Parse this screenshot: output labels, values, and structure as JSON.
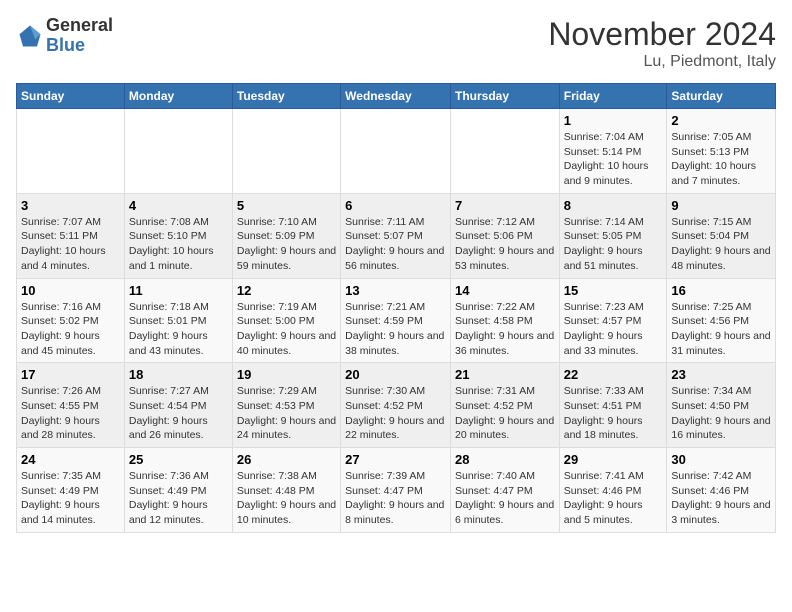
{
  "header": {
    "logo_line1": "General",
    "logo_line2": "Blue",
    "month": "November 2024",
    "location": "Lu, Piedmont, Italy"
  },
  "weekdays": [
    "Sunday",
    "Monday",
    "Tuesday",
    "Wednesday",
    "Thursday",
    "Friday",
    "Saturday"
  ],
  "weeks": [
    [
      {
        "day": "",
        "info": ""
      },
      {
        "day": "",
        "info": ""
      },
      {
        "day": "",
        "info": ""
      },
      {
        "day": "",
        "info": ""
      },
      {
        "day": "",
        "info": ""
      },
      {
        "day": "1",
        "info": "Sunrise: 7:04 AM\nSunset: 5:14 PM\nDaylight: 10 hours\nand 9 minutes."
      },
      {
        "day": "2",
        "info": "Sunrise: 7:05 AM\nSunset: 5:13 PM\nDaylight: 10 hours\nand 7 minutes."
      }
    ],
    [
      {
        "day": "3",
        "info": "Sunrise: 7:07 AM\nSunset: 5:11 PM\nDaylight: 10 hours\nand 4 minutes."
      },
      {
        "day": "4",
        "info": "Sunrise: 7:08 AM\nSunset: 5:10 PM\nDaylight: 10 hours\nand 1 minute."
      },
      {
        "day": "5",
        "info": "Sunrise: 7:10 AM\nSunset: 5:09 PM\nDaylight: 9 hours\nand 59 minutes."
      },
      {
        "day": "6",
        "info": "Sunrise: 7:11 AM\nSunset: 5:07 PM\nDaylight: 9 hours\nand 56 minutes."
      },
      {
        "day": "7",
        "info": "Sunrise: 7:12 AM\nSunset: 5:06 PM\nDaylight: 9 hours\nand 53 minutes."
      },
      {
        "day": "8",
        "info": "Sunrise: 7:14 AM\nSunset: 5:05 PM\nDaylight: 9 hours\nand 51 minutes."
      },
      {
        "day": "9",
        "info": "Sunrise: 7:15 AM\nSunset: 5:04 PM\nDaylight: 9 hours\nand 48 minutes."
      }
    ],
    [
      {
        "day": "10",
        "info": "Sunrise: 7:16 AM\nSunset: 5:02 PM\nDaylight: 9 hours\nand 45 minutes."
      },
      {
        "day": "11",
        "info": "Sunrise: 7:18 AM\nSunset: 5:01 PM\nDaylight: 9 hours\nand 43 minutes."
      },
      {
        "day": "12",
        "info": "Sunrise: 7:19 AM\nSunset: 5:00 PM\nDaylight: 9 hours\nand 40 minutes."
      },
      {
        "day": "13",
        "info": "Sunrise: 7:21 AM\nSunset: 4:59 PM\nDaylight: 9 hours\nand 38 minutes."
      },
      {
        "day": "14",
        "info": "Sunrise: 7:22 AM\nSunset: 4:58 PM\nDaylight: 9 hours\nand 36 minutes."
      },
      {
        "day": "15",
        "info": "Sunrise: 7:23 AM\nSunset: 4:57 PM\nDaylight: 9 hours\nand 33 minutes."
      },
      {
        "day": "16",
        "info": "Sunrise: 7:25 AM\nSunset: 4:56 PM\nDaylight: 9 hours\nand 31 minutes."
      }
    ],
    [
      {
        "day": "17",
        "info": "Sunrise: 7:26 AM\nSunset: 4:55 PM\nDaylight: 9 hours\nand 28 minutes."
      },
      {
        "day": "18",
        "info": "Sunrise: 7:27 AM\nSunset: 4:54 PM\nDaylight: 9 hours\nand 26 minutes."
      },
      {
        "day": "19",
        "info": "Sunrise: 7:29 AM\nSunset: 4:53 PM\nDaylight: 9 hours\nand 24 minutes."
      },
      {
        "day": "20",
        "info": "Sunrise: 7:30 AM\nSunset: 4:52 PM\nDaylight: 9 hours\nand 22 minutes."
      },
      {
        "day": "21",
        "info": "Sunrise: 7:31 AM\nSunset: 4:52 PM\nDaylight: 9 hours\nand 20 minutes."
      },
      {
        "day": "22",
        "info": "Sunrise: 7:33 AM\nSunset: 4:51 PM\nDaylight: 9 hours\nand 18 minutes."
      },
      {
        "day": "23",
        "info": "Sunrise: 7:34 AM\nSunset: 4:50 PM\nDaylight: 9 hours\nand 16 minutes."
      }
    ],
    [
      {
        "day": "24",
        "info": "Sunrise: 7:35 AM\nSunset: 4:49 PM\nDaylight: 9 hours\nand 14 minutes."
      },
      {
        "day": "25",
        "info": "Sunrise: 7:36 AM\nSunset: 4:49 PM\nDaylight: 9 hours\nand 12 minutes."
      },
      {
        "day": "26",
        "info": "Sunrise: 7:38 AM\nSunset: 4:48 PM\nDaylight: 9 hours\nand 10 minutes."
      },
      {
        "day": "27",
        "info": "Sunrise: 7:39 AM\nSunset: 4:47 PM\nDaylight: 9 hours\nand 8 minutes."
      },
      {
        "day": "28",
        "info": "Sunrise: 7:40 AM\nSunset: 4:47 PM\nDaylight: 9 hours\nand 6 minutes."
      },
      {
        "day": "29",
        "info": "Sunrise: 7:41 AM\nSunset: 4:46 PM\nDaylight: 9 hours\nand 5 minutes."
      },
      {
        "day": "30",
        "info": "Sunrise: 7:42 AM\nSunset: 4:46 PM\nDaylight: 9 hours\nand 3 minutes."
      }
    ]
  ]
}
